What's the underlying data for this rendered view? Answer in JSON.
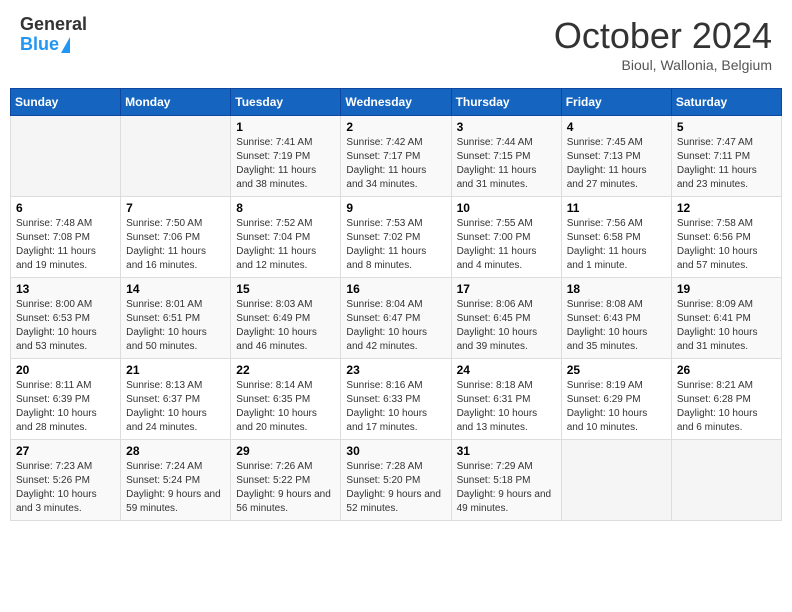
{
  "header": {
    "logo_general": "General",
    "logo_blue": "Blue",
    "month_title": "October 2024",
    "location": "Bioul, Wallonia, Belgium"
  },
  "weekdays": [
    "Sunday",
    "Monday",
    "Tuesday",
    "Wednesday",
    "Thursday",
    "Friday",
    "Saturday"
  ],
  "weeks": [
    [
      {
        "day": "",
        "sunrise": "",
        "sunset": "",
        "daylight": "",
        "empty": true
      },
      {
        "day": "",
        "sunrise": "",
        "sunset": "",
        "daylight": "",
        "empty": true
      },
      {
        "day": "1",
        "sunrise": "Sunrise: 7:41 AM",
        "sunset": "Sunset: 7:19 PM",
        "daylight": "Daylight: 11 hours and 38 minutes."
      },
      {
        "day": "2",
        "sunrise": "Sunrise: 7:42 AM",
        "sunset": "Sunset: 7:17 PM",
        "daylight": "Daylight: 11 hours and 34 minutes."
      },
      {
        "day": "3",
        "sunrise": "Sunrise: 7:44 AM",
        "sunset": "Sunset: 7:15 PM",
        "daylight": "Daylight: 11 hours and 31 minutes."
      },
      {
        "day": "4",
        "sunrise": "Sunrise: 7:45 AM",
        "sunset": "Sunset: 7:13 PM",
        "daylight": "Daylight: 11 hours and 27 minutes."
      },
      {
        "day": "5",
        "sunrise": "Sunrise: 7:47 AM",
        "sunset": "Sunset: 7:11 PM",
        "daylight": "Daylight: 11 hours and 23 minutes."
      }
    ],
    [
      {
        "day": "6",
        "sunrise": "Sunrise: 7:48 AM",
        "sunset": "Sunset: 7:08 PM",
        "daylight": "Daylight: 11 hours and 19 minutes."
      },
      {
        "day": "7",
        "sunrise": "Sunrise: 7:50 AM",
        "sunset": "Sunset: 7:06 PM",
        "daylight": "Daylight: 11 hours and 16 minutes."
      },
      {
        "day": "8",
        "sunrise": "Sunrise: 7:52 AM",
        "sunset": "Sunset: 7:04 PM",
        "daylight": "Daylight: 11 hours and 12 minutes."
      },
      {
        "day": "9",
        "sunrise": "Sunrise: 7:53 AM",
        "sunset": "Sunset: 7:02 PM",
        "daylight": "Daylight: 11 hours and 8 minutes."
      },
      {
        "day": "10",
        "sunrise": "Sunrise: 7:55 AM",
        "sunset": "Sunset: 7:00 PM",
        "daylight": "Daylight: 11 hours and 4 minutes."
      },
      {
        "day": "11",
        "sunrise": "Sunrise: 7:56 AM",
        "sunset": "Sunset: 6:58 PM",
        "daylight": "Daylight: 11 hours and 1 minute."
      },
      {
        "day": "12",
        "sunrise": "Sunrise: 7:58 AM",
        "sunset": "Sunset: 6:56 PM",
        "daylight": "Daylight: 10 hours and 57 minutes."
      }
    ],
    [
      {
        "day": "13",
        "sunrise": "Sunrise: 8:00 AM",
        "sunset": "Sunset: 6:53 PM",
        "daylight": "Daylight: 10 hours and 53 minutes."
      },
      {
        "day": "14",
        "sunrise": "Sunrise: 8:01 AM",
        "sunset": "Sunset: 6:51 PM",
        "daylight": "Daylight: 10 hours and 50 minutes."
      },
      {
        "day": "15",
        "sunrise": "Sunrise: 8:03 AM",
        "sunset": "Sunset: 6:49 PM",
        "daylight": "Daylight: 10 hours and 46 minutes."
      },
      {
        "day": "16",
        "sunrise": "Sunrise: 8:04 AM",
        "sunset": "Sunset: 6:47 PM",
        "daylight": "Daylight: 10 hours and 42 minutes."
      },
      {
        "day": "17",
        "sunrise": "Sunrise: 8:06 AM",
        "sunset": "Sunset: 6:45 PM",
        "daylight": "Daylight: 10 hours and 39 minutes."
      },
      {
        "day": "18",
        "sunrise": "Sunrise: 8:08 AM",
        "sunset": "Sunset: 6:43 PM",
        "daylight": "Daylight: 10 hours and 35 minutes."
      },
      {
        "day": "19",
        "sunrise": "Sunrise: 8:09 AM",
        "sunset": "Sunset: 6:41 PM",
        "daylight": "Daylight: 10 hours and 31 minutes."
      }
    ],
    [
      {
        "day": "20",
        "sunrise": "Sunrise: 8:11 AM",
        "sunset": "Sunset: 6:39 PM",
        "daylight": "Daylight: 10 hours and 28 minutes."
      },
      {
        "day": "21",
        "sunrise": "Sunrise: 8:13 AM",
        "sunset": "Sunset: 6:37 PM",
        "daylight": "Daylight: 10 hours and 24 minutes."
      },
      {
        "day": "22",
        "sunrise": "Sunrise: 8:14 AM",
        "sunset": "Sunset: 6:35 PM",
        "daylight": "Daylight: 10 hours and 20 minutes."
      },
      {
        "day": "23",
        "sunrise": "Sunrise: 8:16 AM",
        "sunset": "Sunset: 6:33 PM",
        "daylight": "Daylight: 10 hours and 17 minutes."
      },
      {
        "day": "24",
        "sunrise": "Sunrise: 8:18 AM",
        "sunset": "Sunset: 6:31 PM",
        "daylight": "Daylight: 10 hours and 13 minutes."
      },
      {
        "day": "25",
        "sunrise": "Sunrise: 8:19 AM",
        "sunset": "Sunset: 6:29 PM",
        "daylight": "Daylight: 10 hours and 10 minutes."
      },
      {
        "day": "26",
        "sunrise": "Sunrise: 8:21 AM",
        "sunset": "Sunset: 6:28 PM",
        "daylight": "Daylight: 10 hours and 6 minutes."
      }
    ],
    [
      {
        "day": "27",
        "sunrise": "Sunrise: 7:23 AM",
        "sunset": "Sunset: 5:26 PM",
        "daylight": "Daylight: 10 hours and 3 minutes."
      },
      {
        "day": "28",
        "sunrise": "Sunrise: 7:24 AM",
        "sunset": "Sunset: 5:24 PM",
        "daylight": "Daylight: 9 hours and 59 minutes."
      },
      {
        "day": "29",
        "sunrise": "Sunrise: 7:26 AM",
        "sunset": "Sunset: 5:22 PM",
        "daylight": "Daylight: 9 hours and 56 minutes."
      },
      {
        "day": "30",
        "sunrise": "Sunrise: 7:28 AM",
        "sunset": "Sunset: 5:20 PM",
        "daylight": "Daylight: 9 hours and 52 minutes."
      },
      {
        "day": "31",
        "sunrise": "Sunrise: 7:29 AM",
        "sunset": "Sunset: 5:18 PM",
        "daylight": "Daylight: 9 hours and 49 minutes."
      },
      {
        "day": "",
        "sunrise": "",
        "sunset": "",
        "daylight": "",
        "empty": true
      },
      {
        "day": "",
        "sunrise": "",
        "sunset": "",
        "daylight": "",
        "empty": true
      }
    ]
  ]
}
